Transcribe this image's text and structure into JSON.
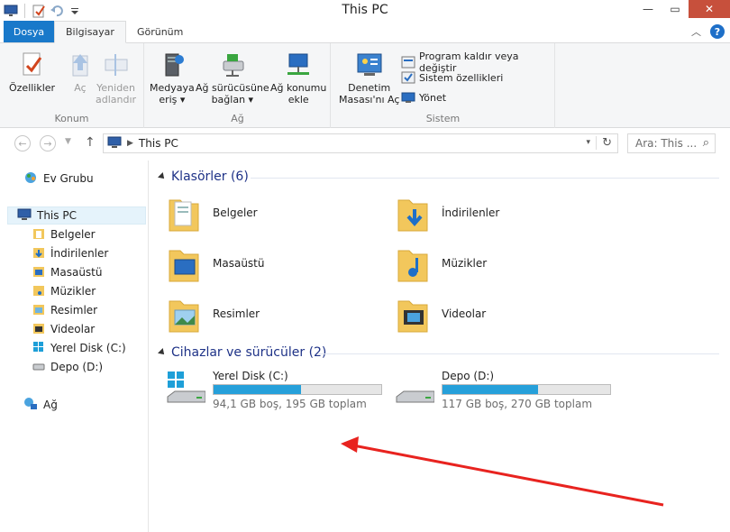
{
  "window": {
    "title": "This PC"
  },
  "tabs": {
    "file": "Dosya",
    "computer": "Bilgisayar",
    "view": "Görünüm"
  },
  "ribbon": {
    "location": {
      "label": "Konum",
      "properties": "Özellikler",
      "open": "Aç",
      "rename_line1": "Yeniden",
      "rename_line2": "adlandır"
    },
    "network": {
      "label": "Ağ",
      "media_line1": "Medyaya",
      "media_line2": "eriş",
      "map_line1": "Ağ sürücüsüne",
      "map_line2": "bağlan",
      "add_line1": "Ağ konumu",
      "add_line2": "ekle"
    },
    "system": {
      "label": "Sistem",
      "control_line1": "Denetim",
      "control_line2": "Masası'nı Aç",
      "uninstall": "Program kaldır veya değiştir",
      "sys_props": "Sistem özellikleri",
      "manage": "Yönet"
    }
  },
  "address": {
    "path": "This PC",
    "search_placeholder": "Ara: This ..."
  },
  "nav": {
    "homegroup": "Ev Grubu",
    "this_pc": "This PC",
    "items": [
      "Belgeler",
      "İndirilenler",
      "Masaüstü",
      "Müzikler",
      "Resimler",
      "Videolar",
      "Yerel Disk (C:)",
      "Depo (D:)"
    ],
    "network": "Ağ"
  },
  "folders": {
    "heading": "Klasörler (6)",
    "items": [
      "Belgeler",
      "İndirilenler",
      "Masaüstü",
      "Müzikler",
      "Resimler",
      "Videolar"
    ]
  },
  "drives": {
    "heading": "Cihazlar ve sürücüler (2)",
    "items": [
      {
        "name": "Yerel Disk (C:)",
        "info": "94,1 GB boş, 195 GB toplam",
        "used_fraction": 0.52
      },
      {
        "name": "Depo (D:)",
        "info": "117 GB boş, 270 GB toplam",
        "used_fraction": 0.57
      }
    ]
  },
  "colors": {
    "accent": "#1979ca",
    "bar_fill": "#26a0da",
    "annotation_arrow": "#e8231f"
  }
}
